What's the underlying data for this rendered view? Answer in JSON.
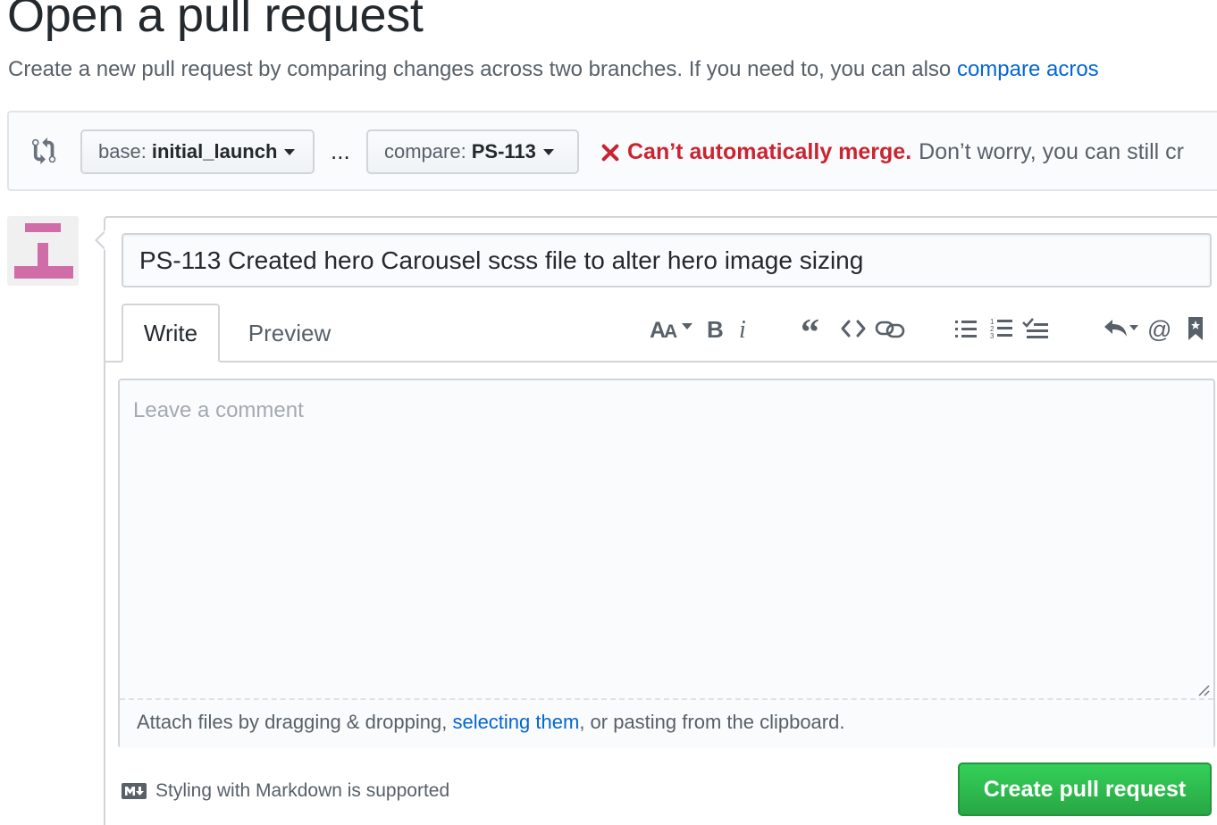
{
  "page": {
    "title": "Open a pull request",
    "subtitle_text": "Create a new pull request by comparing changes across two branches. If you need to, you can also ",
    "subtitle_link": "compare acros"
  },
  "range": {
    "icon": "git-compare-icon",
    "base_prefix": "base:",
    "base_branch": "initial_launch",
    "separator": "...",
    "compare_prefix": "compare:",
    "compare_branch": "PS-113",
    "merge_icon": "x-icon",
    "merge_status": "Can’t automatically merge.",
    "merge_rest": "Don’t worry, you can still cr",
    "status_color": "#cb2431"
  },
  "avatar": {
    "icon": "identicon-avatar",
    "color": "#d06da8"
  },
  "form": {
    "title_value": "PS-113 Created hero Carousel scss file to alter hero image sizing",
    "tabs": [
      {
        "label": "Write",
        "active": true
      },
      {
        "label": "Preview",
        "active": false
      }
    ],
    "toolbar": [
      "text-size-icon",
      "bold-icon",
      "italic-icon",
      "quote-icon",
      "code-icon",
      "link-icon",
      "unordered-list-icon",
      "ordered-list-icon",
      "task-list-icon",
      "reply-icon",
      "mention-icon",
      "bookmark-icon"
    ],
    "comment_placeholder": "Leave a comment",
    "attach_before": "Attach files by dragging & dropping, ",
    "attach_link": "selecting them",
    "attach_after": ", or pasting from the clipboard.",
    "markdown_note": "Styling with Markdown is supported",
    "submit_label": "Create pull request",
    "accent": "#28a745",
    "link_color": "#0366d6"
  }
}
